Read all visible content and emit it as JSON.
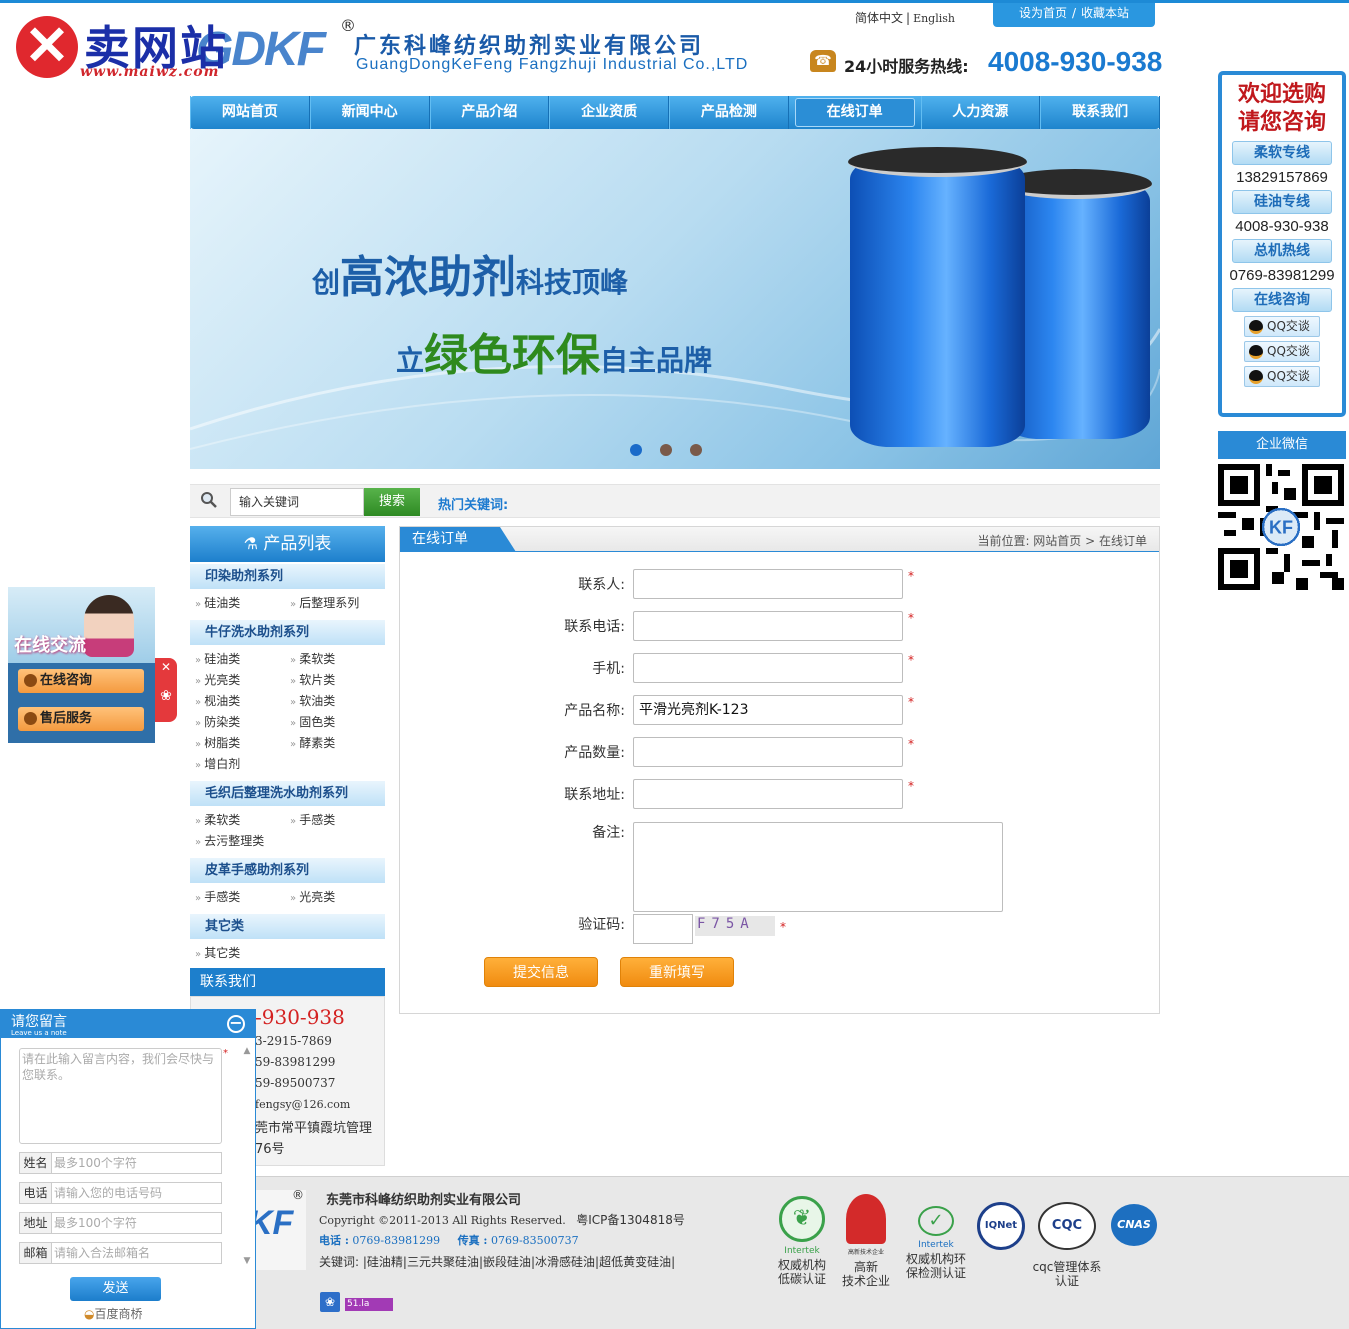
{
  "header": {
    "lang": [
      "简体中文",
      "English"
    ],
    "top_links": [
      "设为首页",
      "收藏本站"
    ],
    "watermark": {
      "text": "卖网站",
      "url": "www.maiwz.com"
    },
    "logo_text": "GDKF",
    "reg_mark": "®",
    "company_cn": "广东科峰纺织助剂实业有限公司",
    "company_en": "GuangDongKeFeng Fangzhuji Industrial Co.,LTD",
    "hotline_label": "24小时服务热线:",
    "hotline": "4008-930-938"
  },
  "nav": {
    "items": [
      "网站首页",
      "新闻中心",
      "产品介绍",
      "企业资质",
      "产品检测",
      "在线订单",
      "人力资源",
      "联系我们"
    ],
    "active": "在线订单"
  },
  "banner": {
    "line1_a": "创",
    "line1_b": "高浓助剂",
    "line1_c": "科技顶峰",
    "line2_a": "立",
    "line2_b": "绿色环保",
    "line2_c": "自主品牌",
    "slides": 3,
    "active_slide": 1
  },
  "search": {
    "placeholder": "输入关键词",
    "button": "搜索",
    "hot_label": "热门关键词:"
  },
  "sidebar": {
    "title": "产品列表",
    "categories": [
      {
        "name": "印染助剂系列",
        "subs": [
          "硅油类",
          "后整理系列"
        ]
      },
      {
        "name": "牛仔洗水助剂系列",
        "subs": [
          "硅油类",
          "柔软类",
          "光亮类",
          "软片类",
          "枧油类",
          "软油类",
          "防染类",
          "固色类",
          "树脂类",
          "酵素类",
          "增白剂"
        ]
      },
      {
        "name": "毛织后整理洗水助剂系列",
        "subs": [
          "柔软类",
          "手感类",
          "去污整理类"
        ]
      },
      {
        "name": "皮革手感助剂系列",
        "subs": [
          "手感类",
          "光亮类"
        ]
      },
      {
        "name": "其它类",
        "subs": [
          "其它类"
        ]
      }
    ],
    "contact_title": "联系我们",
    "contact_lines": [
      "-930-938",
      "3-2915-7869",
      "59-83981299",
      "59-89500737",
      "fengsy@126.com",
      "莞市常平镇霞坑管理",
      "76号"
    ]
  },
  "main": {
    "tab": "在线订单",
    "crumb": "当前位置: 网站首页 > 在线订单",
    "fields": [
      {
        "label": "联系人:",
        "value": "",
        "required": "*"
      },
      {
        "label": "联系电话:",
        "value": "",
        "required": "*"
      },
      {
        "label": "手机:",
        "value": "",
        "required": "*"
      },
      {
        "label": "产品名称:",
        "value": "平滑光亮剂K-123",
        "required": "*"
      },
      {
        "label": "产品数量:",
        "value": "",
        "required": "*"
      },
      {
        "label": "联系地址:",
        "value": "",
        "required": "*"
      }
    ],
    "note_label": "备注:",
    "captcha_label": "验证码:",
    "captcha_text": "F75A",
    "captcha_required": "*",
    "submit": "提交信息",
    "reset": "重新填写"
  },
  "right_panel": {
    "title1": "欢迎选购",
    "title2": "请您咨询",
    "lines": [
      {
        "label": "柔软专线",
        "num": "13829157869"
      },
      {
        "label": "硅油专线",
        "num": "4008-930-938"
      },
      {
        "label": "总机热线",
        "num": "0769-83981299"
      }
    ],
    "consult": "在线咨询",
    "qq": [
      "QQ交谈",
      "QQ交谈",
      "QQ交谈"
    ],
    "wechat": "企业微信"
  },
  "left_panel": {
    "title": "在线交流",
    "btn1": "在线咨询",
    "btn2": "售后服务",
    "close": "✕"
  },
  "msgbox": {
    "title": "请您留言",
    "subtitle": "Leave us a note",
    "placeholder": "请在此输入留言内容，我们会尽快与您联系。",
    "fields": [
      {
        "label": "姓名",
        "placeholder": "最多100个字符"
      },
      {
        "label": "电话",
        "placeholder": "请输入您的电话号码"
      },
      {
        "label": "地址",
        "placeholder": "最多100个字符"
      },
      {
        "label": "邮箱",
        "placeholder": "请输入合法邮箱名"
      }
    ],
    "send": "发送",
    "brand": "百度商桥"
  },
  "footer": {
    "company": "东莞市科峰纺织助剂实业有限公司",
    "copyright": "Copyright ©2011-2013 All Rights Reserved.",
    "icp": "粤ICP备1304818号",
    "tel_label": "电话 :",
    "tel": "0769-83981299",
    "fax_label": "传真 :",
    "fax": "0769-83500737",
    "keywords": "关键词: |硅油精|三元共聚硅油|嵌段硅油|冰滑感硅油|超低黄变硅油|",
    "certs": [
      {
        "caption1": "权威机构",
        "caption2": "低碳认证",
        "mark": "Intertek"
      },
      {
        "caption1": "高新",
        "caption2": "技术企业",
        "mark": "高新技术企业"
      },
      {
        "caption1": "权威机构环",
        "caption2": "保检测认证",
        "mark": "Intertek"
      },
      {
        "caption1": "",
        "caption2": "",
        "mark": "IQNet"
      },
      {
        "caption1": "cqc管理体系认证",
        "caption2": "",
        "mark": "CQC"
      },
      {
        "caption1": "",
        "caption2": "",
        "mark": "CNAS"
      }
    ],
    "badge2": "51.la"
  }
}
